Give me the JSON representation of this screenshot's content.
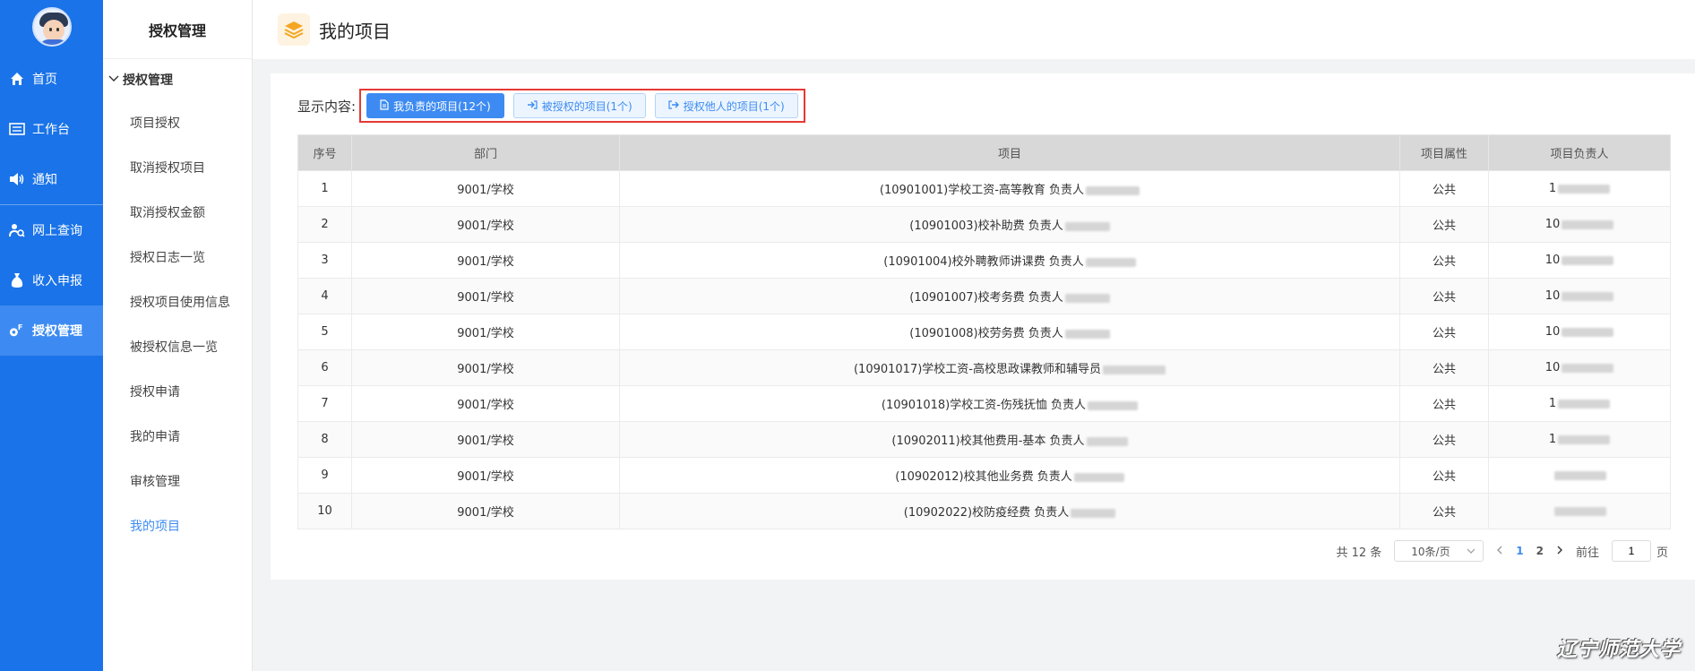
{
  "nav": {
    "items": [
      {
        "label": "首页",
        "icon": "home-icon"
      },
      {
        "label": "工作台",
        "icon": "workbench-icon"
      },
      {
        "label": "通知",
        "icon": "speaker-icon"
      },
      {
        "label": "网上查询",
        "icon": "query-icon"
      },
      {
        "label": "收入申报",
        "icon": "money-bag-icon"
      },
      {
        "label": "授权管理",
        "icon": "authorization-icon"
      }
    ]
  },
  "subnav": {
    "title": "授权管理",
    "group": "授权管理",
    "items": [
      "项目授权",
      "取消授权项目",
      "取消授权金额",
      "授权日志一览",
      "授权项目使用信息",
      "被授权信息一览",
      "授权申请",
      "我的申请",
      "审核管理",
      "我的项目"
    ]
  },
  "header": {
    "title": "我的项目"
  },
  "filter": {
    "label": "显示内容:",
    "buttons": [
      "我负责的项目(12个)",
      "被授权的项目(1个)",
      "授权他人的项目(1个)"
    ]
  },
  "table": {
    "headers": [
      "序号",
      "部门",
      "项目",
      "项目属性",
      "项目负责人"
    ],
    "rows": [
      {
        "no": "1",
        "dept": "9001/学校",
        "project": "(10901001)学校工资-高等教育 负责人",
        "attr": "公共",
        "owner": "1"
      },
      {
        "no": "2",
        "dept": "9001/学校",
        "project": "(10901003)校补助费 负责人",
        "attr": "公共",
        "owner": "10"
      },
      {
        "no": "3",
        "dept": "9001/学校",
        "project": "(10901004)校外聘教师讲课费 负责人",
        "attr": "公共",
        "owner": "10"
      },
      {
        "no": "4",
        "dept": "9001/学校",
        "project": "(10901007)校考务费 负责人",
        "attr": "公共",
        "owner": "10"
      },
      {
        "no": "5",
        "dept": "9001/学校",
        "project": "(10901008)校劳务费 负责人",
        "attr": "公共",
        "owner": "10"
      },
      {
        "no": "6",
        "dept": "9001/学校",
        "project": "(10901017)学校工资-高校思政课教师和辅导员",
        "attr": "公共",
        "owner": "10"
      },
      {
        "no": "7",
        "dept": "9001/学校",
        "project": "(10901018)学校工资-伤残抚恤 负责人",
        "attr": "公共",
        "owner": "1"
      },
      {
        "no": "8",
        "dept": "9001/学校",
        "project": "(10902011)校其他费用-基本 负责人",
        "attr": "公共",
        "owner": "1"
      },
      {
        "no": "9",
        "dept": "9001/学校",
        "project": "(10902012)校其他业务费 负责人",
        "attr": "公共",
        "owner": ""
      },
      {
        "no": "10",
        "dept": "9001/学校",
        "project": "(10902022)校防疫经费 负责人",
        "attr": "公共",
        "owner": ""
      }
    ]
  },
  "pager": {
    "total": "共 12 条",
    "page_size": "10条/页",
    "pages": [
      "1",
      "2"
    ],
    "goto_label": "前往",
    "goto_value": "1",
    "page_unit": "页"
  },
  "watermark": "辽宁师范大学",
  "colors": {
    "primary": "#1a73e8",
    "accent": "#3d8bf2",
    "highlight_border": "#e53935"
  }
}
